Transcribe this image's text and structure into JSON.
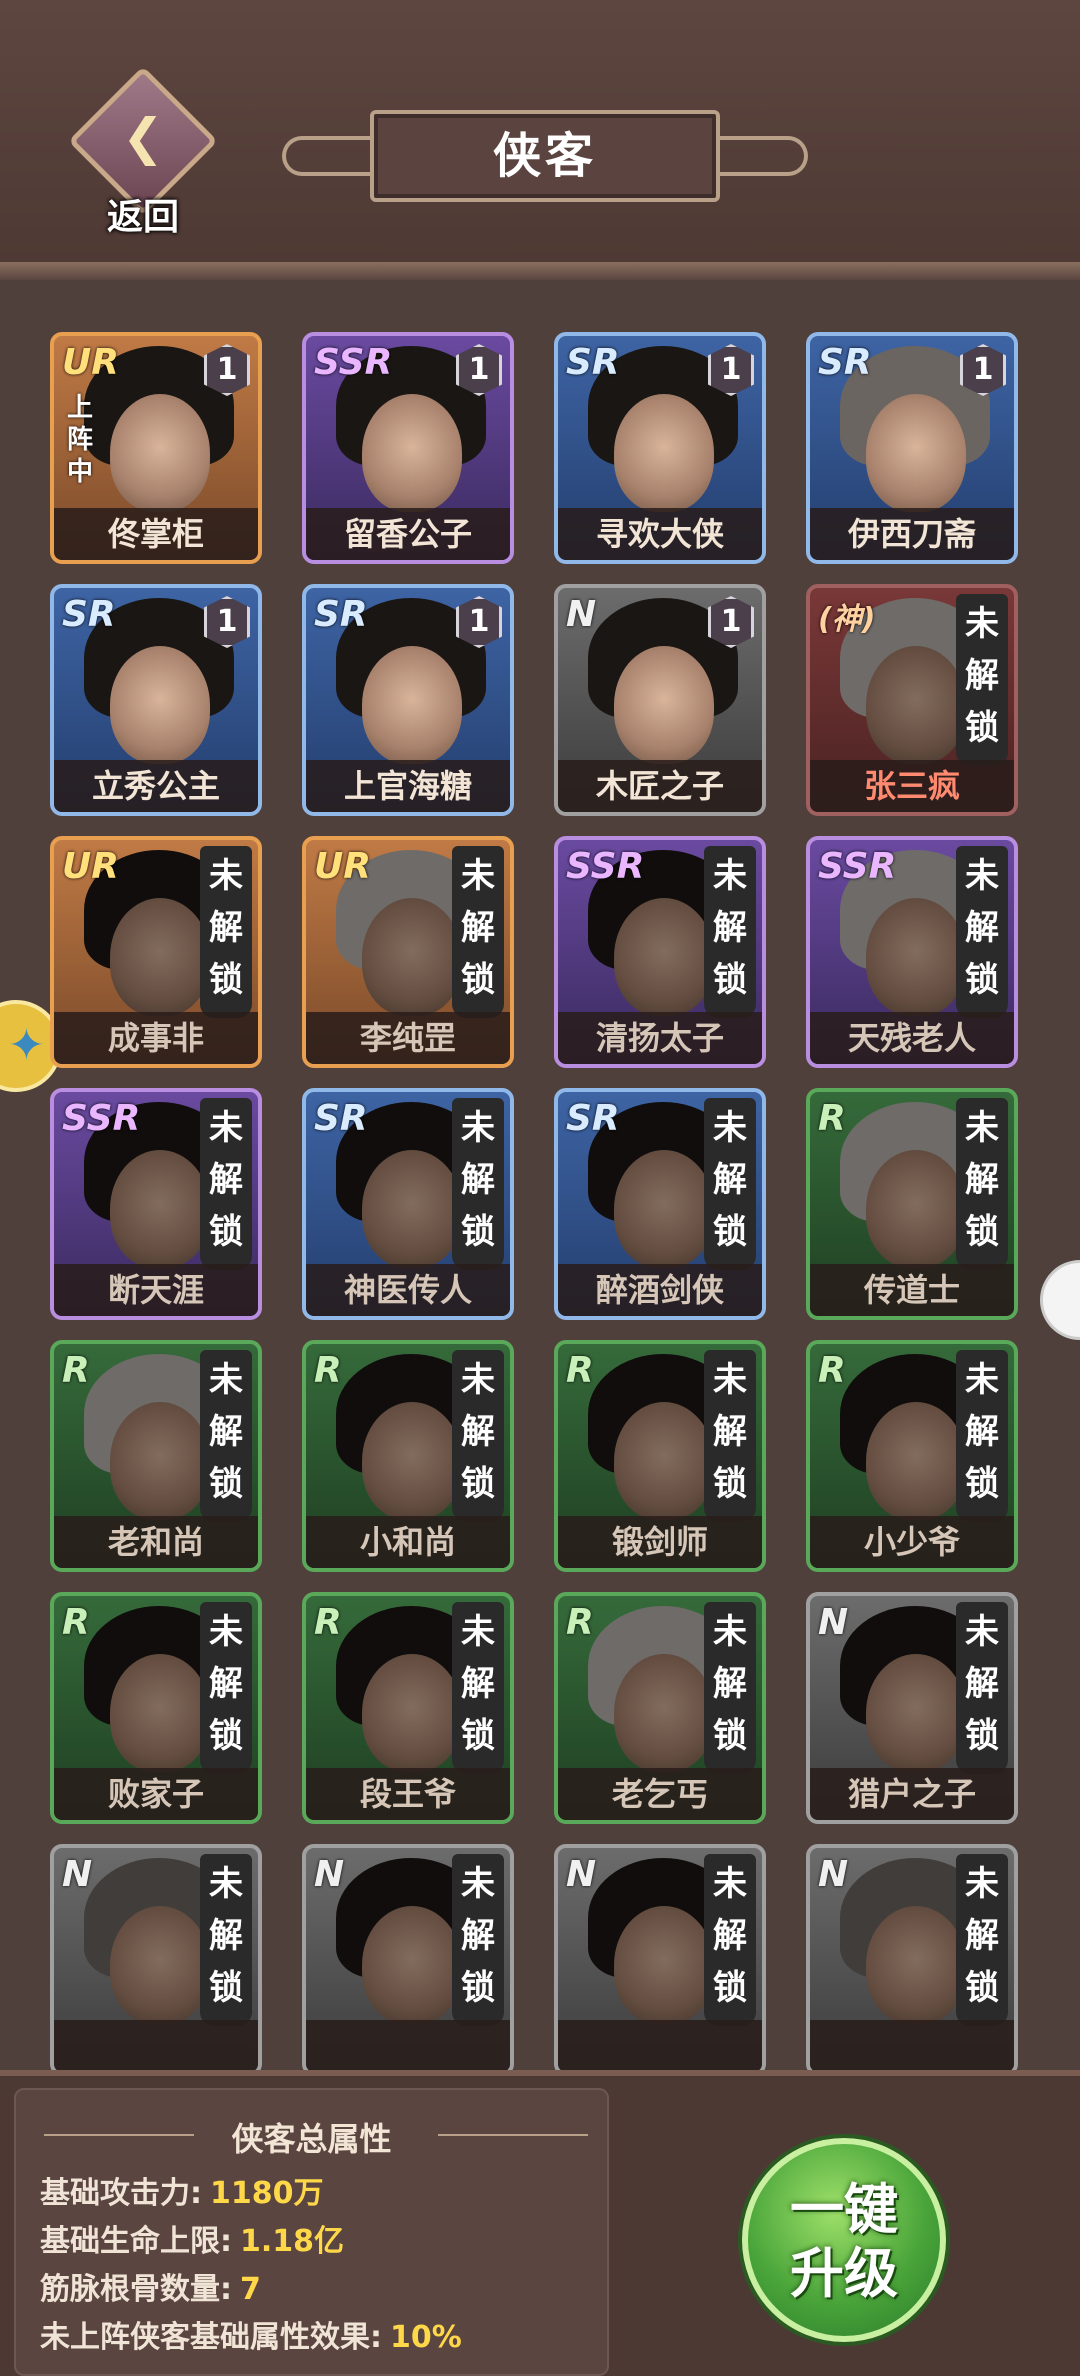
{
  "header": {
    "back_label": "返回",
    "title": "侠客"
  },
  "heroes": [
    {
      "name": "佟掌柜",
      "rarity": "UR",
      "level": "1",
      "locked": false,
      "on_team": "上阵中"
    },
    {
      "name": "留香公子",
      "rarity": "SSR",
      "level": "1",
      "locked": false
    },
    {
      "name": "寻欢大侠",
      "rarity": "SR",
      "level": "1",
      "locked": false
    },
    {
      "name": "伊西刀斋",
      "rarity": "SR",
      "level": "1",
      "locked": false
    },
    {
      "name": "立秀公主",
      "rarity": "SR",
      "level": "1",
      "locked": false
    },
    {
      "name": "上官海糖",
      "rarity": "SR",
      "level": "1",
      "locked": false
    },
    {
      "name": "木匠之子",
      "rarity": "N",
      "level": "1",
      "locked": false
    },
    {
      "name": "张三疯",
      "rarity": "(神)",
      "locked": true,
      "lock_label": "未解锁"
    },
    {
      "name": "成事非",
      "rarity": "UR",
      "locked": true,
      "lock_label": "未解锁"
    },
    {
      "name": "李纯罡",
      "rarity": "UR",
      "locked": true,
      "lock_label": "未解锁"
    },
    {
      "name": "清扬太子",
      "rarity": "SSR",
      "locked": true,
      "lock_label": "未解锁"
    },
    {
      "name": "天残老人",
      "rarity": "SSR",
      "locked": true,
      "lock_label": "未解锁"
    },
    {
      "name": "断天涯",
      "rarity": "SSR",
      "locked": true,
      "lock_label": "未解锁"
    },
    {
      "name": "神医传人",
      "rarity": "SR",
      "locked": true,
      "lock_label": "未解锁"
    },
    {
      "name": "醉酒剑侠",
      "rarity": "SR",
      "locked": true,
      "lock_label": "未解锁"
    },
    {
      "name": "传道士",
      "rarity": "R",
      "locked": true,
      "lock_label": "未解锁"
    },
    {
      "name": "老和尚",
      "rarity": "R",
      "locked": true,
      "lock_label": "未解锁"
    },
    {
      "name": "小和尚",
      "rarity": "R",
      "locked": true,
      "lock_label": "未解锁"
    },
    {
      "name": "锻剑师",
      "rarity": "R",
      "locked": true,
      "lock_label": "未解锁"
    },
    {
      "name": "小少爷",
      "rarity": "R",
      "locked": true,
      "lock_label": "未解锁"
    },
    {
      "name": "败家子",
      "rarity": "R",
      "locked": true,
      "lock_label": "未解锁"
    },
    {
      "name": "段王爷",
      "rarity": "R",
      "locked": true,
      "lock_label": "未解锁"
    },
    {
      "name": "老乞丐",
      "rarity": "R",
      "locked": true,
      "lock_label": "未解锁"
    },
    {
      "name": "猎户之子",
      "rarity": "N",
      "locked": true,
      "lock_label": "未解锁"
    },
    {
      "name": "",
      "rarity": "N",
      "locked": true,
      "lock_label": "未解锁"
    },
    {
      "name": "",
      "rarity": "N",
      "locked": true,
      "lock_label": "未解锁"
    },
    {
      "name": "",
      "rarity": "N",
      "locked": true,
      "lock_label": "未解锁"
    },
    {
      "name": "",
      "rarity": "N",
      "locked": true,
      "lock_label": "未解锁"
    }
  ],
  "stats": {
    "title": "侠客总属性",
    "rows": [
      {
        "label": "基础攻击力:",
        "value": "1180万"
      },
      {
        "label": "基础生命上限:",
        "value": "1.18亿"
      },
      {
        "label": "筋脉根骨数量:",
        "value": "7"
      },
      {
        "label": "未上阵侠客基础属性效果:",
        "value": "10%"
      }
    ]
  },
  "upgrade": {
    "line1": "一键",
    "line2": "升级"
  }
}
